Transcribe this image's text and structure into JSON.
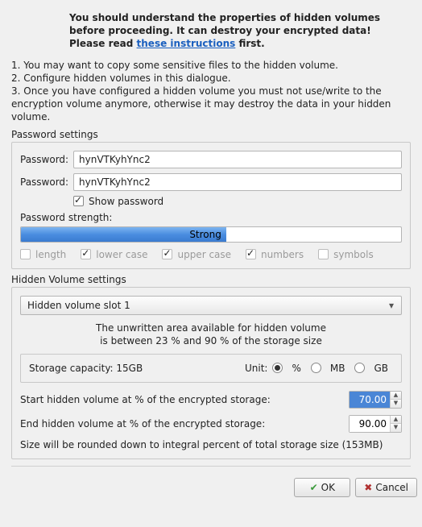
{
  "warning": {
    "line1": "You should understand the properties of hidden volumes before proceeding. It can destroy your encrypted data! Please read ",
    "link": "these instructions",
    "tail": " first."
  },
  "steps": {
    "s1": "1. You may want to copy some sensitive files to the hidden volume.",
    "s2": "2. Configure hidden volumes in this dialogue.",
    "s3": "3. Once you have configured a hidden volume you must not use/write to the encryption volume anymore, otherwise it may destroy the data in your hidden volume."
  },
  "pw": {
    "section": "Password settings",
    "label": "Password:",
    "value": "hynVTKyhYnc2",
    "show": "Show password",
    "strength_label": "Password strength:",
    "strength_value": "Strong",
    "strength_pct": 54,
    "criteria": {
      "length": "length",
      "lower": "lower case",
      "upper": "upper case",
      "numbers": "numbers",
      "symbols": "symbols"
    }
  },
  "hv": {
    "section": "Hidden Volume settings",
    "slot": "Hidden volume slot 1",
    "hint1": "The unwritten area available for hidden volume",
    "hint2": "is between 23 % and 90 % of the storage size",
    "capacity": "Storage capacity: 15GB",
    "unit_label": "Unit:",
    "units": {
      "pct": "%",
      "mb": "MB",
      "gb": "GB"
    },
    "start_label": "Start hidden volume at % of the encrypted storage:",
    "start_value": "70.00",
    "end_label": "End hidden volume at % of the encrypted storage:",
    "end_value": "90.00",
    "note": "Size will be rounded down to integral percent of total storage size (153MB)"
  },
  "buttons": {
    "ok": "OK",
    "cancel": "Cancel"
  }
}
